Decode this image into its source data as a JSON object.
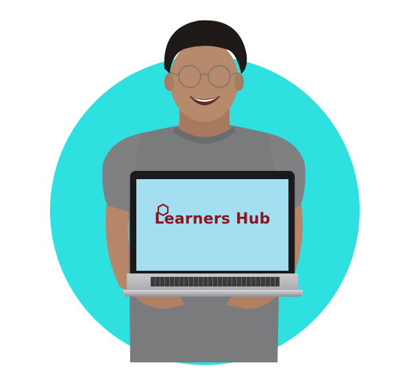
{
  "colors": {
    "background": "#ffffff",
    "circle": "#2ee0e0",
    "screen": "#a3dff0",
    "brand": "#8c1620",
    "shirt": "#7a7b7d",
    "skin": "#b5866a",
    "hair": "#1f1a17"
  },
  "screen": {
    "brand_text": "Learners Hub",
    "logo_icon": "hexagon-outline-icon"
  }
}
